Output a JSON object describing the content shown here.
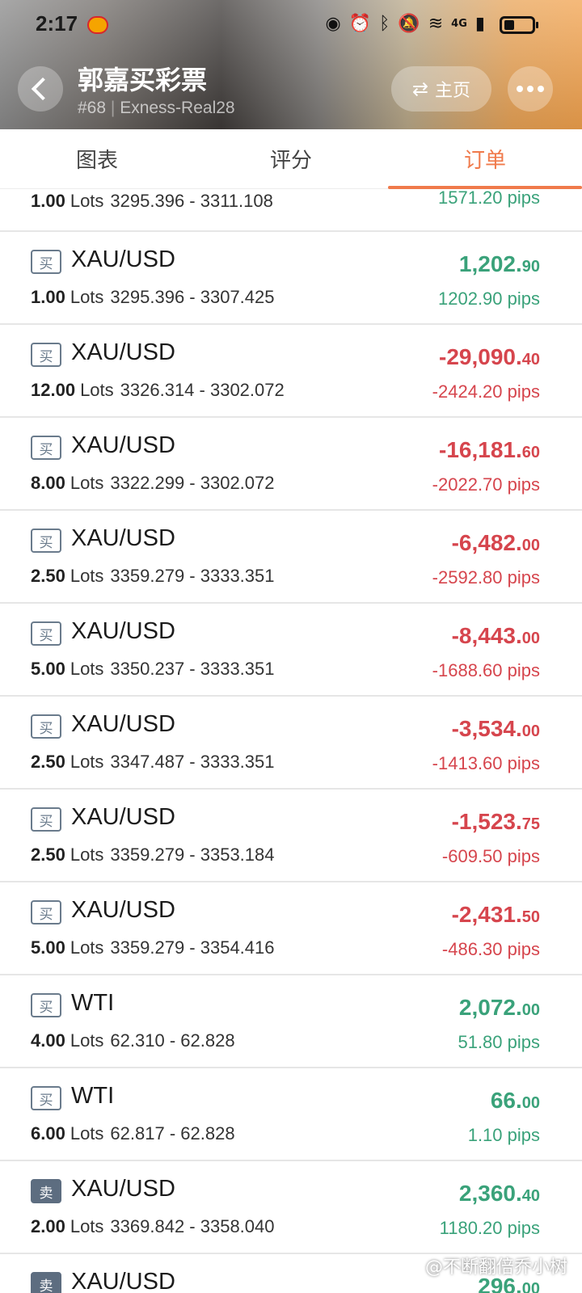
{
  "status_bar": {
    "time": "2:17",
    "network": "4G"
  },
  "header": {
    "title": "郭嘉买彩票",
    "subtitle_rank": "#68",
    "subtitle_account": "Exness-Real28",
    "home_label": "主页"
  },
  "tabs": [
    {
      "label": "图表",
      "active": false
    },
    {
      "label": "评分",
      "active": false
    },
    {
      "label": "订单",
      "active": true
    }
  ],
  "colors": {
    "accent": "#f07a4b",
    "profit": "#3aa27a",
    "loss": "#d6454d"
  },
  "orders": [
    {
      "side": "",
      "symbol": "",
      "lots": "1.00",
      "lots_unit": "Lots",
      "prices": "3295.396 - 3311.108",
      "pnl_main": "",
      "pnl_cents": "",
      "pips": "1571.20 pips",
      "positive": true
    },
    {
      "side": "买",
      "symbol": "XAU/USD",
      "lots": "1.00",
      "lots_unit": "Lots",
      "prices": "3295.396 - 3307.425",
      "pnl_main": "1,202.",
      "pnl_cents": "90",
      "pips": "1202.90 pips",
      "positive": true
    },
    {
      "side": "买",
      "symbol": "XAU/USD",
      "lots": "12.00",
      "lots_unit": "Lots",
      "prices": "3326.314 - 3302.072",
      "pnl_main": "-29,090.",
      "pnl_cents": "40",
      "pips": "-2424.20 pips",
      "positive": false
    },
    {
      "side": "买",
      "symbol": "XAU/USD",
      "lots": "8.00",
      "lots_unit": "Lots",
      "prices": "3322.299 - 3302.072",
      "pnl_main": "-16,181.",
      "pnl_cents": "60",
      "pips": "-2022.70 pips",
      "positive": false
    },
    {
      "side": "买",
      "symbol": "XAU/USD",
      "lots": "2.50",
      "lots_unit": "Lots",
      "prices": "3359.279 - 3333.351",
      "pnl_main": "-6,482.",
      "pnl_cents": "00",
      "pips": "-2592.80 pips",
      "positive": false
    },
    {
      "side": "买",
      "symbol": "XAU/USD",
      "lots": "5.00",
      "lots_unit": "Lots",
      "prices": "3350.237 - 3333.351",
      "pnl_main": "-8,443.",
      "pnl_cents": "00",
      "pips": "-1688.60 pips",
      "positive": false
    },
    {
      "side": "买",
      "symbol": "XAU/USD",
      "lots": "2.50",
      "lots_unit": "Lots",
      "prices": "3347.487 - 3333.351",
      "pnl_main": "-3,534.",
      "pnl_cents": "00",
      "pips": "-1413.60 pips",
      "positive": false
    },
    {
      "side": "买",
      "symbol": "XAU/USD",
      "lots": "2.50",
      "lots_unit": "Lots",
      "prices": "3359.279 - 3353.184",
      "pnl_main": "-1,523.",
      "pnl_cents": "75",
      "pips": "-609.50 pips",
      "positive": false
    },
    {
      "side": "买",
      "symbol": "XAU/USD",
      "lots": "5.00",
      "lots_unit": "Lots",
      "prices": "3359.279 - 3354.416",
      "pnl_main": "-2,431.",
      "pnl_cents": "50",
      "pips": "-486.30 pips",
      "positive": false
    },
    {
      "side": "买",
      "symbol": "WTI",
      "lots": "4.00",
      "lots_unit": "Lots",
      "prices": "62.310 - 62.828",
      "pnl_main": "2,072.",
      "pnl_cents": "00",
      "pips": "51.80 pips",
      "positive": true
    },
    {
      "side": "买",
      "symbol": "WTI",
      "lots": "6.00",
      "lots_unit": "Lots",
      "prices": "62.817 - 62.828",
      "pnl_main": "66.",
      "pnl_cents": "00",
      "pips": "1.10 pips",
      "positive": true
    },
    {
      "side": "卖",
      "symbol": "XAU/USD",
      "lots": "2.00",
      "lots_unit": "Lots",
      "prices": "3369.842 - 3358.040",
      "pnl_main": "2,360.",
      "pnl_cents": "40",
      "pips": "1180.20 pips",
      "positive": true
    },
    {
      "side": "卖",
      "symbol": "XAU/USD",
      "lots": "",
      "lots_unit": "",
      "prices": "",
      "pnl_main": "296.",
      "pnl_cents": "00",
      "pips": "",
      "positive": true
    }
  ],
  "watermark": "@不断翻倍乔小树"
}
